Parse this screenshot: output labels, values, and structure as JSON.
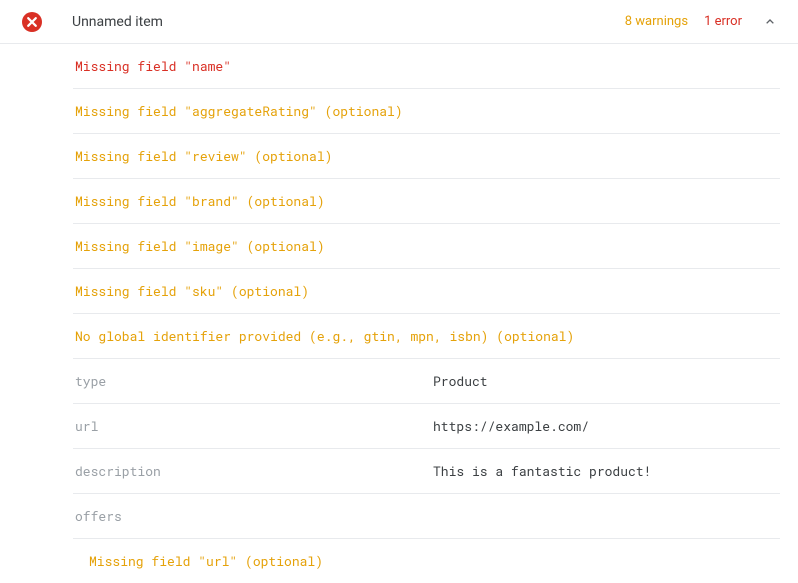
{
  "header": {
    "title": "Unnamed item",
    "warnings_label": "8 warnings",
    "errors_label": "1 error"
  },
  "messages": [
    {
      "text": "Missing field \"name\"",
      "severity": "error"
    },
    {
      "text": "Missing field \"aggregateRating\" (optional)",
      "severity": "warning"
    },
    {
      "text": "Missing field \"review\" (optional)",
      "severity": "warning"
    },
    {
      "text": "Missing field \"brand\" (optional)",
      "severity": "warning"
    },
    {
      "text": "Missing field \"image\" (optional)",
      "severity": "warning"
    },
    {
      "text": "Missing field \"sku\" (optional)",
      "severity": "warning"
    },
    {
      "text": "No global identifier provided (e.g., gtin, mpn, isbn) (optional)",
      "severity": "warning"
    }
  ],
  "properties": [
    {
      "key": "type",
      "value": "Product"
    },
    {
      "key": "url",
      "value": "https://example.com/"
    },
    {
      "key": "description",
      "value": "This is a fantastic product!"
    }
  ],
  "offers": {
    "label": "offers",
    "messages": [
      {
        "text": "Missing field \"url\" (optional)",
        "severity": "warning"
      }
    ]
  }
}
